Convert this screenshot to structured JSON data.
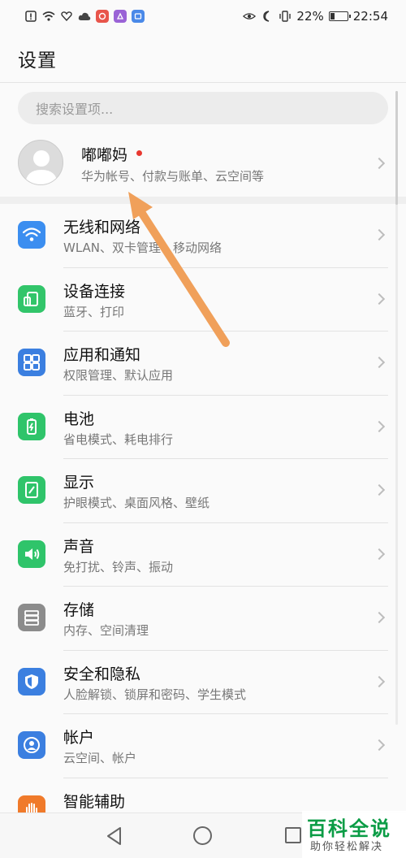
{
  "status_bar": {
    "battery_percent": "22%",
    "battery_level": 0.22,
    "time": "22:54",
    "left_icons": [
      "alert-icon",
      "wifi-signal-icon",
      "heart-icon",
      "cloud-icon",
      "app-red-icon",
      "app-purple-icon",
      "app-blue-icon"
    ],
    "right_icons": [
      "eye-comfort-icon",
      "moon-icon",
      "vibrate-icon"
    ]
  },
  "header": {
    "title": "设置"
  },
  "search": {
    "placeholder": "搜索设置项..."
  },
  "account": {
    "name": "嘟嘟妈",
    "subtitle": "华为帐号、付款与账单、云空间等",
    "has_notification": true
  },
  "settings": [
    {
      "key": "wireless",
      "title": "无线和网络",
      "subtitle": "WLAN、双卡管理、移动网络",
      "icon": "wifi-icon",
      "color": "#3b8ef0"
    },
    {
      "key": "device-connection",
      "title": "设备连接",
      "subtitle": "蓝牙、打印",
      "icon": "device-connection-icon",
      "color": "#32c56a"
    },
    {
      "key": "apps-notifications",
      "title": "应用和通知",
      "subtitle": "权限管理、默认应用",
      "icon": "apps-grid-icon",
      "color": "#3b7fe0"
    },
    {
      "key": "battery",
      "title": "电池",
      "subtitle": "省电模式、耗电排行",
      "icon": "battery-icon",
      "color": "#2fc46a"
    },
    {
      "key": "display",
      "title": "显示",
      "subtitle": "护眼模式、桌面风格、壁纸",
      "icon": "display-icon",
      "color": "#2fc46a"
    },
    {
      "key": "sound",
      "title": "声音",
      "subtitle": "免打扰、铃声、振动",
      "icon": "speaker-icon",
      "color": "#2fc46a"
    },
    {
      "key": "storage",
      "title": "存储",
      "subtitle": "内存、空间清理",
      "icon": "storage-icon",
      "color": "#8c8c8c"
    },
    {
      "key": "security-privacy",
      "title": "安全和隐私",
      "subtitle": "人脸解锁、锁屏和密码、学生模式",
      "icon": "shield-icon",
      "color": "#3b7fe0"
    },
    {
      "key": "accounts",
      "title": "帐户",
      "subtitle": "云空间、帐户",
      "icon": "account-icon",
      "color": "#3b7fe0"
    },
    {
      "key": "accessibility",
      "title": "智能辅助",
      "subtitle": "",
      "icon": "hand-icon",
      "color": "#f07a2a"
    }
  ],
  "navigation_bar": {
    "buttons": [
      "back-icon",
      "home-icon",
      "recents-icon"
    ]
  },
  "watermark": {
    "title": "百科全说",
    "subtitle": "助你轻松解决"
  },
  "annotation": {
    "color": "#f0a05a"
  }
}
